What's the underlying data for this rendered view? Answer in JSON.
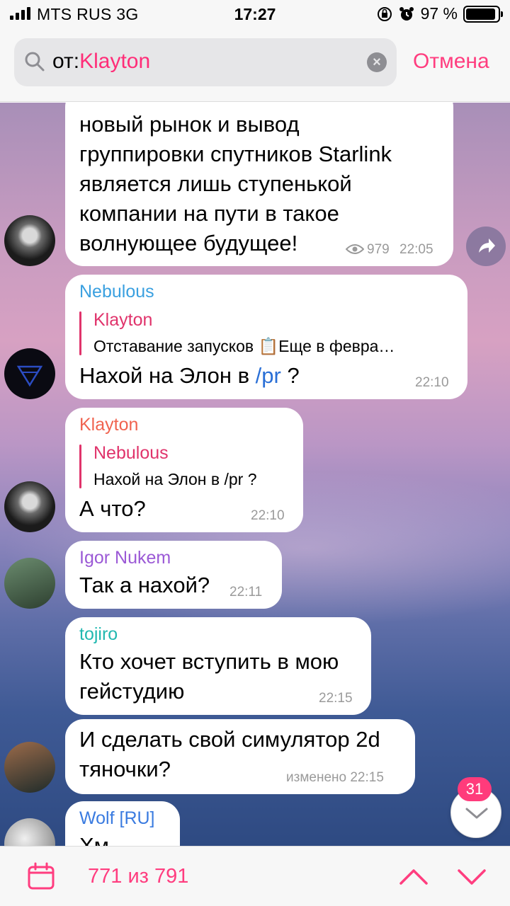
{
  "status_bar": {
    "carrier": "MTS RUS  3G",
    "time": "17:27",
    "battery": "97 %",
    "battery_level": 0.97
  },
  "search": {
    "prefix": "от:",
    "query": "Klayton",
    "cancel_label": "Отмена"
  },
  "messages": [
    {
      "text": "новый рынок и вывод\nгруппировки спутников Starlink\nявляется лишь ступенькой\nкомпании на пути в такое\nволнующее будущее!",
      "views": "979",
      "time": "22:05"
    },
    {
      "sender": "Nebulous",
      "reply_to_name": "Klayton",
      "reply_text": "Отставание запусков 📋Еще в февра…",
      "text_before_link": "Нахой на Элон в ",
      "link": "/pr",
      "text_after_link": " ?",
      "time": "22:10"
    },
    {
      "sender": "Klayton",
      "reply_to_name": "Nebulous",
      "reply_text": "Нахой на Элон в /pr ?",
      "text": "А что?",
      "time": "22:10"
    },
    {
      "sender": "Igor Nukem",
      "text": "Так а нахой?",
      "time": "22:11"
    },
    {
      "sender": "tojiro",
      "text": "Кто хочет вступить в мою\nгейстудию",
      "time": "22:15"
    },
    {
      "text": "И сделать свой симулятор 2d\nтяночки?",
      "time": "изменено 22:15"
    },
    {
      "sender": "Wolf [RU]",
      "text": "Хм"
    }
  ],
  "unread_badge": "31",
  "bottom_bar": {
    "counter": "771 из 791"
  },
  "colors": {
    "accent": "#ff3d7f",
    "klayton_name": "#f0634f",
    "nebulous_name": "#3aa0e0",
    "igor_name": "#9b59d6",
    "tojiro_name": "#22b8b0",
    "wolf_name": "#3a7be0",
    "link": "#2a6fd6"
  }
}
